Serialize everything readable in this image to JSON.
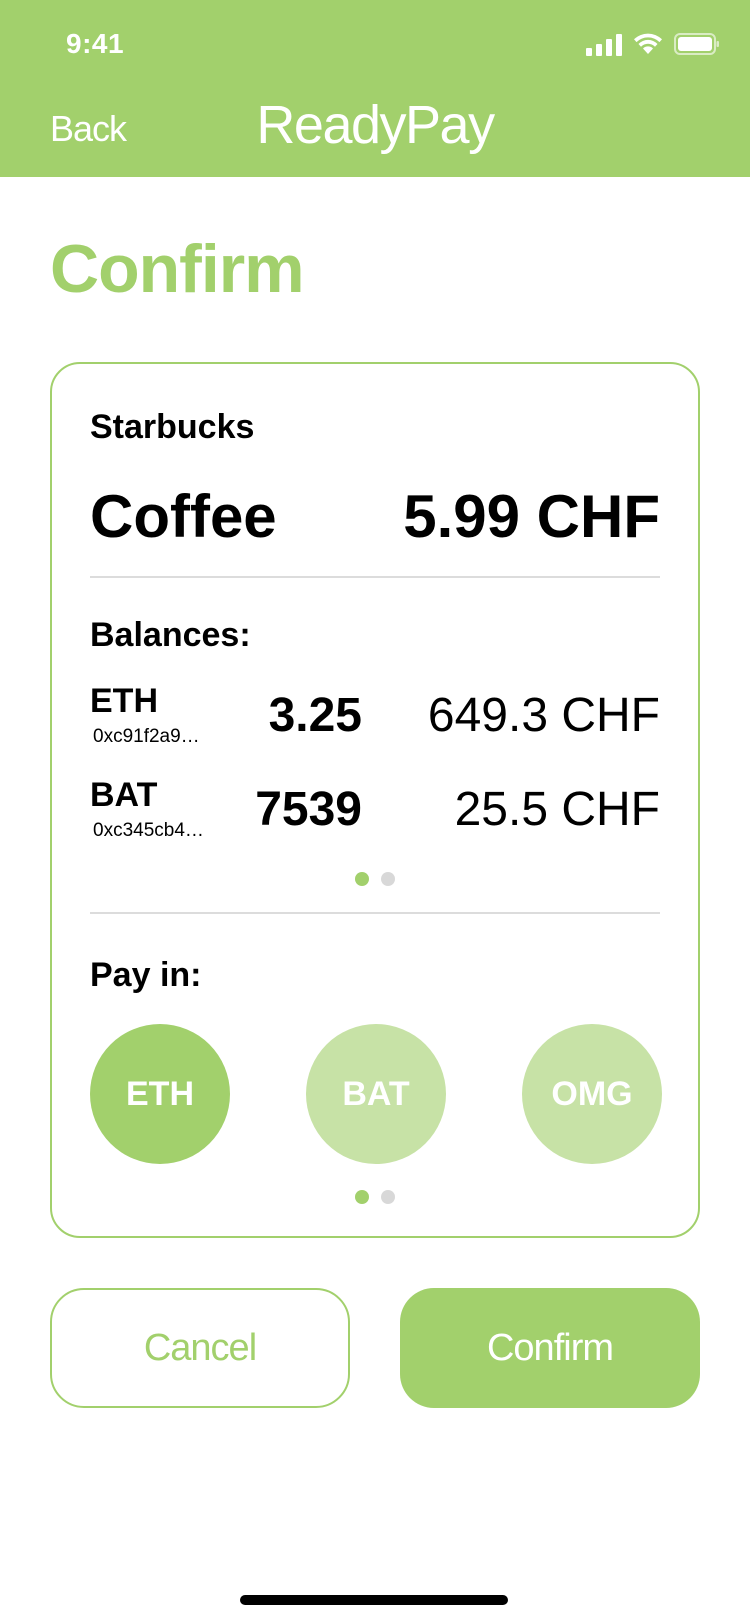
{
  "status_bar": {
    "time": "9:41",
    "icons": [
      "signal-icon",
      "wifi-icon",
      "battery-icon"
    ]
  },
  "nav": {
    "back_label": "Back",
    "app_title": "ReadyPay"
  },
  "page_title": "Confirm",
  "order": {
    "merchant": "Starbucks",
    "item": "Coffee",
    "price": "5.99 CHF"
  },
  "balances": {
    "label": "Balances:",
    "rows": [
      {
        "symbol": "ETH",
        "address": "0xc91f2a9…",
        "amount": "3.25",
        "fiat": "649.3 CHF"
      },
      {
        "symbol": "BAT",
        "address": "0xc345cb4…",
        "amount": "7539",
        "fiat": "25.5 CHF"
      }
    ],
    "page_count": 2,
    "active_page": 1
  },
  "pay_in": {
    "label": "Pay in:",
    "options": [
      {
        "label": "ETH",
        "selected": true
      },
      {
        "label": "BAT",
        "selected": false
      },
      {
        "label": "OMG",
        "selected": false
      }
    ],
    "page_count": 2,
    "active_page": 1
  },
  "actions": {
    "cancel_label": "Cancel",
    "confirm_label": "Confirm"
  },
  "colors": {
    "accent": "#a2d06c",
    "accent_light": "#c7e2a6",
    "divider": "#dcdcdc",
    "dot_inactive": "#d8d8d8"
  }
}
